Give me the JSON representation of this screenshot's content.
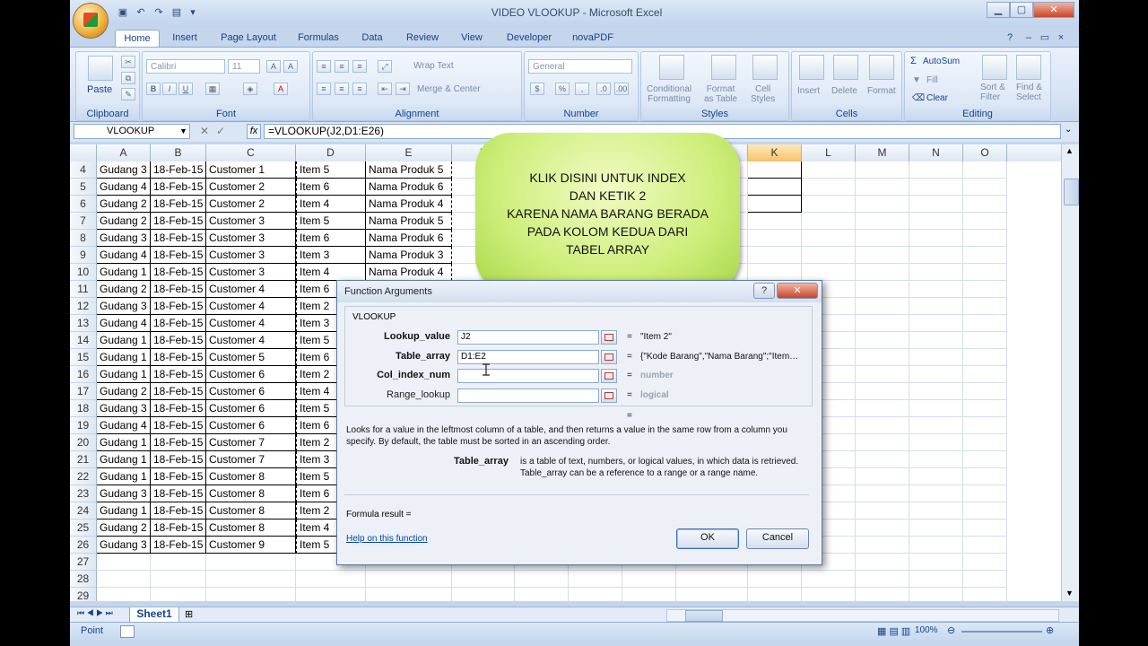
{
  "app": {
    "title": "VIDEO VLOOKUP - Microsoft Excel",
    "controls": {
      "minimize": "▁",
      "maximize": "▢",
      "close": "✕"
    }
  },
  "ribbon": {
    "tabs": [
      "Home",
      "Insert",
      "Page Layout",
      "Formulas",
      "Data",
      "Review",
      "View",
      "Developer",
      "novaPDF"
    ],
    "groups": {
      "clipboard": {
        "label": "Clipboard",
        "paste": "Paste"
      },
      "font": {
        "label": "Font",
        "font_name": "Calibri",
        "font_size": "11"
      },
      "alignment": {
        "label": "Alignment",
        "wrap_text": "Wrap Text",
        "merge_center": "Merge & Center"
      },
      "number": {
        "label": "Number",
        "format": "General"
      },
      "styles": {
        "label": "Styles",
        "conditional": "Conditional\nFormatting",
        "format_table": "Format\nas Table",
        "cell_styles": "Cell\nStyles"
      },
      "cells": {
        "label": "Cells",
        "insert": "Insert",
        "delete": "Delete",
        "format": "Format"
      },
      "editing": {
        "label": "Editing",
        "autosum": "AutoSum",
        "fill": "Fill",
        "clear": "Clear",
        "sort": "Sort &\nFilter",
        "find": "Find &\nSelect"
      }
    }
  },
  "formula_bar": {
    "name_box": "VLOOKUP",
    "fx": "fx",
    "formula": "=VLOOKUP(J2,D1:E26)"
  },
  "grid": {
    "columns": [
      "A",
      "B",
      "C",
      "D",
      "E",
      "F",
      "G",
      "H",
      "I",
      "J",
      "K",
      "L",
      "M",
      "N",
      "O"
    ],
    "rows": [
      {
        "n": "4",
        "cells": [
          "Gudang 3",
          "18-Feb-15",
          "Customer 1",
          "Item 5",
          "Nama Produk 5"
        ]
      },
      {
        "n": "5",
        "cells": [
          "Gudang 4",
          "18-Feb-15",
          "Customer 2",
          "Item 6",
          "Nama Produk 6"
        ]
      },
      {
        "n": "6",
        "cells": [
          "Gudang 2",
          "18-Feb-15",
          "Customer 2",
          "Item 4",
          "Nama Produk 4"
        ]
      },
      {
        "n": "7",
        "cells": [
          "Gudang 2",
          "18-Feb-15",
          "Customer 3",
          "Item 5",
          "Nama Produk 5"
        ]
      },
      {
        "n": "8",
        "cells": [
          "Gudang 3",
          "18-Feb-15",
          "Customer 3",
          "Item 6",
          "Nama Produk 6"
        ]
      },
      {
        "n": "9",
        "cells": [
          "Gudang 4",
          "18-Feb-15",
          "Customer 3",
          "Item 3",
          "Nama Produk 3"
        ]
      },
      {
        "n": "10",
        "cells": [
          "Gudang 1",
          "18-Feb-15",
          "Customer 3",
          "Item 4",
          "Nama Produk 4"
        ]
      },
      {
        "n": "11",
        "cells": [
          "Gudang 2",
          "18-Feb-15",
          "Customer 4",
          "Item 6",
          ""
        ]
      },
      {
        "n": "12",
        "cells": [
          "Gudang 3",
          "18-Feb-15",
          "Customer 4",
          "Item 2",
          ""
        ]
      },
      {
        "n": "13",
        "cells": [
          "Gudang 4",
          "18-Feb-15",
          "Customer 4",
          "Item 3",
          ""
        ]
      },
      {
        "n": "14",
        "cells": [
          "Gudang 1",
          "18-Feb-15",
          "Customer 4",
          "Item 5",
          ""
        ]
      },
      {
        "n": "15",
        "cells": [
          "Gudang 1",
          "18-Feb-15",
          "Customer 5",
          "Item 6",
          ""
        ]
      },
      {
        "n": "16",
        "cells": [
          "Gudang 1",
          "18-Feb-15",
          "Customer 6",
          "Item 2",
          ""
        ]
      },
      {
        "n": "17",
        "cells": [
          "Gudang 2",
          "18-Feb-15",
          "Customer 6",
          "Item 4",
          ""
        ]
      },
      {
        "n": "18",
        "cells": [
          "Gudang 3",
          "18-Feb-15",
          "Customer 6",
          "Item 5",
          ""
        ]
      },
      {
        "n": "19",
        "cells": [
          "Gudang 4",
          "18-Feb-15",
          "Customer 6",
          "Item 6",
          ""
        ]
      },
      {
        "n": "20",
        "cells": [
          "Gudang 1",
          "18-Feb-15",
          "Customer 7",
          "Item 2",
          ""
        ]
      },
      {
        "n": "21",
        "cells": [
          "Gudang 1",
          "18-Feb-15",
          "Customer 7",
          "Item 3",
          ""
        ]
      },
      {
        "n": "22",
        "cells": [
          "Gudang 1",
          "18-Feb-15",
          "Customer 8",
          "Item 5",
          ""
        ]
      },
      {
        "n": "23",
        "cells": [
          "Gudang 3",
          "18-Feb-15",
          "Customer 8",
          "Item 6",
          ""
        ]
      },
      {
        "n": "24",
        "cells": [
          "Gudang 1",
          "18-Feb-15",
          "Customer 8",
          "Item 2",
          ""
        ]
      },
      {
        "n": "25",
        "cells": [
          "Gudang 2",
          "18-Feb-15",
          "Customer 8",
          "Item 4",
          ""
        ]
      },
      {
        "n": "26",
        "cells": [
          "Gudang 3",
          "18-Feb-15",
          "Customer 9",
          "Item 5",
          ""
        ]
      },
      {
        "n": "27",
        "cells": [
          "",
          "",
          "",
          "",
          ""
        ]
      },
      {
        "n": "28",
        "cells": [
          "",
          "",
          "",
          "",
          ""
        ]
      },
      {
        "n": "29",
        "cells": [
          "",
          "",
          "",
          "",
          ""
        ]
      },
      {
        "n": "30",
        "cells": [
          "",
          "",
          "",
          "",
          ""
        ]
      }
    ]
  },
  "callout": {
    "lines": [
      "KLIK DISINI UNTUK INDEX",
      "DAN KETIK 2",
      "KARENA NAMA BARANG BERADA",
      "PADA KOLOM KEDUA DARI",
      "TABEL ARRAY"
    ],
    "colors": {
      "fill": "#cdee7a",
      "edge": "#a8d646"
    }
  },
  "dialog": {
    "title": "Function Arguments",
    "help_btn": "?",
    "close_btn": "✕",
    "function_name": "VLOOKUP",
    "args": [
      {
        "label": "Lookup_value",
        "value": "J2",
        "result": "\"Item 2\"",
        "bold": true,
        "gray": false
      },
      {
        "label": "Table_array",
        "value": "D1:E2",
        "result": "{\"Kode Barang\",\"Nama Barang\";\"Item…",
        "bold": true,
        "gray": false
      },
      {
        "label": "Col_index_num",
        "value": "",
        "result": "number",
        "bold": true,
        "gray": true
      },
      {
        "label": "Range_lookup",
        "value": "",
        "result": "logical",
        "bold": false,
        "gray": true
      }
    ],
    "equals": "=",
    "description": "Looks for a value in the leftmost column of a table, and then returns a value in the same row from a column you specify. By default, the table must be sorted in an ascending order.",
    "arg_help_name": "Table_array",
    "arg_help_text": "is a table of text, numbers, or logical values, in which data is retrieved. Table_array can be a reference to a range or a range name.",
    "formula_result": "Formula result =",
    "help_link": "Help on this function",
    "ok": "OK",
    "cancel": "Cancel"
  },
  "sheets": {
    "active": "Sheet1"
  },
  "status": {
    "mode": "Point",
    "zoom": "100%"
  }
}
